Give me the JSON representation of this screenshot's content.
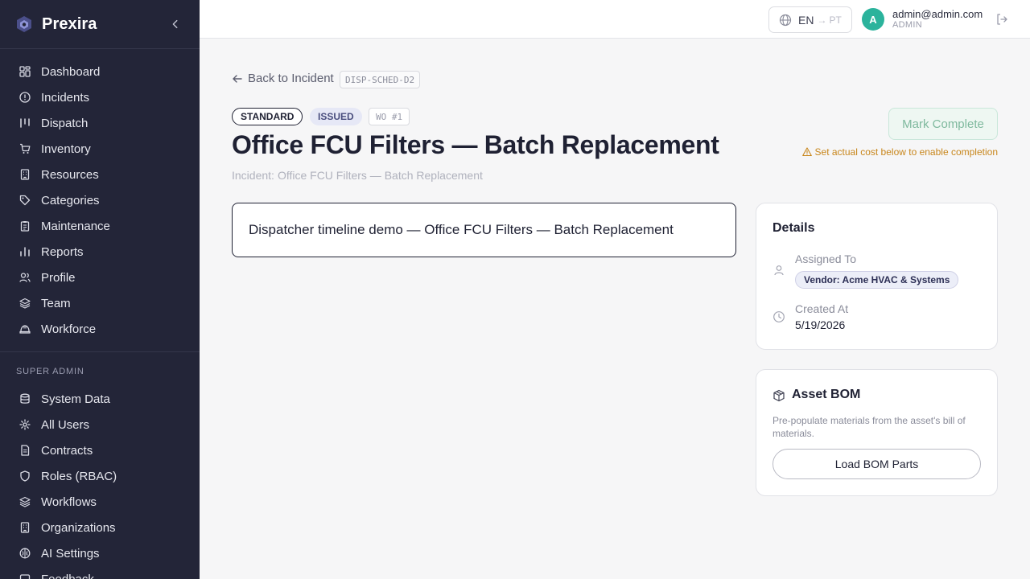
{
  "app": {
    "name": "Prexira",
    "accent_color": "#232538"
  },
  "sidebar": {
    "items": [
      {
        "label": "Dashboard",
        "icon": "grid-icon"
      },
      {
        "label": "Incidents",
        "icon": "alert-circle-icon"
      },
      {
        "label": "Dispatch",
        "icon": "columns-icon"
      },
      {
        "label": "Inventory",
        "icon": "cart-icon"
      },
      {
        "label": "Resources",
        "icon": "building-icon"
      },
      {
        "label": "Categories",
        "icon": "tag-icon"
      },
      {
        "label": "Maintenance",
        "icon": "clipboard-icon"
      },
      {
        "label": "Reports",
        "icon": "bar-chart-icon"
      },
      {
        "label": "Profile",
        "icon": "users-icon"
      },
      {
        "label": "Team",
        "icon": "layers-icon"
      },
      {
        "label": "Workforce",
        "icon": "hard-hat-icon"
      }
    ],
    "super_admin_label": "SUPER ADMIN",
    "admin_items": [
      {
        "label": "System Data",
        "icon": "database-icon"
      },
      {
        "label": "All Users",
        "icon": "gear-icon"
      },
      {
        "label": "Contracts",
        "icon": "file-icon"
      },
      {
        "label": "Roles (RBAC)",
        "icon": "shield-icon"
      },
      {
        "label": "Workflows",
        "icon": "layers-icon"
      },
      {
        "label": "Organizations",
        "icon": "building-icon"
      },
      {
        "label": "AI Settings",
        "icon": "brain-icon"
      },
      {
        "label": "Feedback",
        "icon": "message-icon"
      }
    ]
  },
  "topbar": {
    "lang_from": "EN",
    "lang_arrow": "→",
    "lang_to": "PT",
    "avatar_initial": "A",
    "user_email": "admin@admin.com",
    "user_role": "ADMIN"
  },
  "page": {
    "back_label": "Back to Incident",
    "incident_code": "DISP-SCHED-D2",
    "badge_type": "STANDARD",
    "badge_status": "ISSUED",
    "badge_wo": "WO #1",
    "title": "Office FCU Filters — Batch Replacement",
    "subtitle_label": "Incident:",
    "subtitle_value": "Office FCU Filters — Batch Replacement",
    "mark_complete_label": "Mark Complete",
    "warning_text": "Set actual cost below to enable completion",
    "description": "Dispatcher timeline demo — Office FCU Filters — Batch Replacement"
  },
  "details": {
    "heading": "Details",
    "assigned_label": "Assigned To",
    "assigned_value": "Vendor: Acme HVAC & Systems",
    "created_label": "Created At",
    "created_value": "5/19/2026"
  },
  "bom": {
    "heading": "Asset BOM",
    "description": "Pre-populate materials from the asset's bill of materials.",
    "button_label": "Load BOM Parts"
  }
}
